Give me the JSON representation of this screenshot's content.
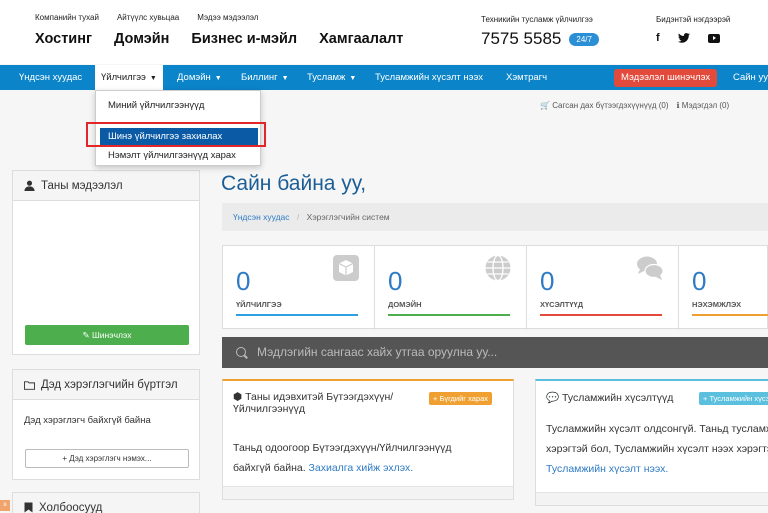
{
  "header": {
    "top_links": [
      "Компанийн тухай",
      "Айтүүлс хувьцаа",
      "Мэдээ мэдээлэл"
    ],
    "main_links": [
      "Хостинг",
      "Домэйн",
      "Бизнес и-мэйл",
      "Хамгаалалт"
    ],
    "support_label": "Техникийн тусламж үйлчилгээ",
    "phone": "7575 5585",
    "badge": "24/7",
    "social_label": "Бидэнтэй нэгдээрэй",
    "social": {
      "facebook": "f",
      "twitter": "🐦"
    }
  },
  "nav": {
    "items": [
      {
        "label": "Үндсэн хуудас",
        "caret": false
      },
      {
        "label": "Үйлчилгээ",
        "caret": true
      },
      {
        "label": "Домэйн",
        "caret": true
      },
      {
        "label": "Биллинг",
        "caret": true
      },
      {
        "label": "Тусламж",
        "caret": true
      },
      {
        "label": "Тусламжийн хүсэлт нээх",
        "caret": false
      },
      {
        "label": "Хэмтрагч",
        "caret": false
      }
    ],
    "update_button": "Мэдээлэл шинэчлэх",
    "right_partial": "Сайн уу"
  },
  "dropdown": {
    "items": [
      "Миний үйлчилгээнүүд",
      "Шинэ үйлчилгээ захиалах",
      "Нэмэлт үйлчилгээнүүд харах"
    ]
  },
  "subrow": {
    "saved": "Сагсан дах бүтээгдэхүүнүүд (0)",
    "notices": "Мэдэгдэл (0)"
  },
  "sidebar": {
    "info_title": "Таны мэдээлэл",
    "update_button": "Шинэчлэх",
    "subaccount_title": "Дэд хэрэглэгчийн бүртгэл",
    "subaccount_empty": "Дэд хэрэглэгч байхгүй байна",
    "add_subaccount_button": "+ Дэд хэрэглэгч нэмэх...",
    "links_title": "Холбоосууд"
  },
  "main": {
    "greeting": "Сайн байна уу,",
    "breadcrumb": {
      "home": "Үндсэн хуудас",
      "sep": "/",
      "current": "Хэрэглэгчийн систем"
    },
    "stats": [
      {
        "num": "0",
        "label": "Үйлчилгээ",
        "color": "#2e9fe0"
      },
      {
        "num": "0",
        "label": "Домэйн",
        "color": "#4cae4c"
      },
      {
        "num": "0",
        "label": "Хүсэлтүүд",
        "color": "#e24a3b"
      },
      {
        "num": "0",
        "label": "Нэхэмжлэх",
        "color": "#f0a030"
      }
    ],
    "search_placeholder": "Мэдлэгийн сангаас хайх утгаа оруулна уу...",
    "products_card": {
      "title_line1": "Таны идэвхитэй Бүтээгдэхүүн/",
      "title_line2": "Үйлчилгээнүүд",
      "badge": "+ Бүгдийг харах",
      "body_line1": "Таньд одоогоор Бүтээгдэхүүн/Үйлчилгээнүүд",
      "body_line2": "байхгүй байна.",
      "body_link": "Захиалга хийж эхлэх."
    },
    "tickets_card": {
      "title": "Тусламжийн хүсэлтүүд",
      "badge": "+ Тусламжийн хүсэлт нээх",
      "body_line1": "Тусламжийн хүсэлт олдсонгүй. Таньд тусламж",
      "body_line2": "хэрэгтэй бол, Тусламжийн хүсэлт нээх хэрэгтэй.",
      "body_link": "Тусламжийн хүсэлт нээх."
    }
  },
  "colors": {
    "nav": "#0b84c9",
    "accent": "#2e7bc4",
    "red": "#e24a3b",
    "green": "#4cae4c"
  }
}
